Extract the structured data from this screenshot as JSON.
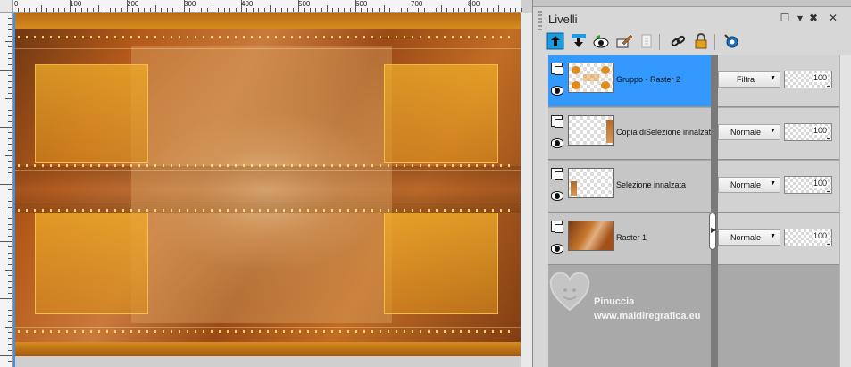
{
  "ruler": {
    "h_labels": [
      "0",
      "100",
      "200",
      "300",
      "400",
      "500",
      "600",
      "700",
      "800"
    ]
  },
  "layers_panel": {
    "title": "Livelli",
    "title_controls": [
      "☐",
      "▾",
      "✖",
      "✕"
    ],
    "toolbar_icons": [
      "new-raster-layer-icon",
      "new-mask-layer-icon",
      "view-layers-icon",
      "edit-layer-icon",
      "delete-layer-icon",
      "link-layers-icon",
      "lock-layer-icon",
      "layer-properties-icon"
    ],
    "layers": [
      {
        "name": "Gruppo - Raster 2",
        "blend": "Filtra",
        "opacity": "100",
        "selected": true
      },
      {
        "name": "Copia diSelezione innalzata",
        "blend": "Normale",
        "opacity": "100",
        "selected": false
      },
      {
        "name": "Selezione innalzata",
        "blend": "Normale",
        "opacity": "100",
        "selected": false
      },
      {
        "name": "Raster 1",
        "blend": "Normale",
        "opacity": "100",
        "selected": false
      }
    ],
    "blend_arrow": "▼",
    "splitter_arrow": "▶"
  },
  "watermark": {
    "name": "Pinuccia",
    "url": "www.maidiregrafica.eu"
  },
  "colors": {
    "selection": "#3399ff",
    "gold": "#e6a72a",
    "rust": "#b45a1a"
  }
}
